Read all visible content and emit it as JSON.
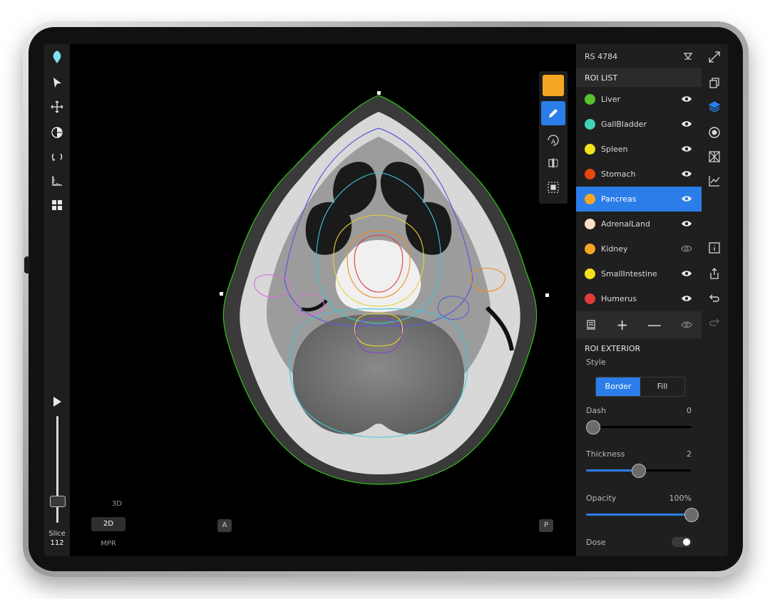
{
  "viewer": {
    "view_3d": "3D",
    "view_2d": "2D",
    "view_mpr": "MPR",
    "orient_left": "A",
    "orient_right": "P",
    "slice_label": "Slice",
    "slice_value": "112"
  },
  "palette": {
    "color_swatch": "#f5a623"
  },
  "panel": {
    "structure_set": "RS 4784",
    "roi_list_title": "ROI LIST",
    "rois": [
      {
        "name": "Liver",
        "color": "#57c22d",
        "visible": true
      },
      {
        "name": "GallBladder",
        "color": "#3fd4b4",
        "visible": true
      },
      {
        "name": "Spleen",
        "color": "#f2e11b",
        "visible": true
      },
      {
        "name": "Stomach",
        "color": "#e8470f",
        "visible": true
      },
      {
        "name": "Pancreas",
        "color": "#f5a623",
        "visible": true,
        "selected": true
      },
      {
        "name": "AdrenalLand",
        "color": "#fbe0c6",
        "visible": true
      },
      {
        "name": "Kidney",
        "color": "#f5a623",
        "visible": false
      },
      {
        "name": "SmallIntestine",
        "color": "#f2e11b",
        "visible": true
      },
      {
        "name": "Humerus",
        "color": "#e23a3a",
        "visible": true
      }
    ],
    "exterior_title": "ROI EXTERIOR",
    "style_label": "Style",
    "style_border": "Border",
    "style_fill": "Fill",
    "dash_label": "Dash",
    "dash_value": "0",
    "dash_fraction": 0.0,
    "thickness_label": "Thickness",
    "thickness_value": "2",
    "thickness_fraction": 0.5,
    "opacity_label": "Opacity",
    "opacity_value": "100%",
    "opacity_fraction": 1.0,
    "dose_label": "Dose",
    "dose_on": true
  },
  "colors": {
    "accent": "#2b7de9",
    "panel": "#1f1f1f"
  }
}
